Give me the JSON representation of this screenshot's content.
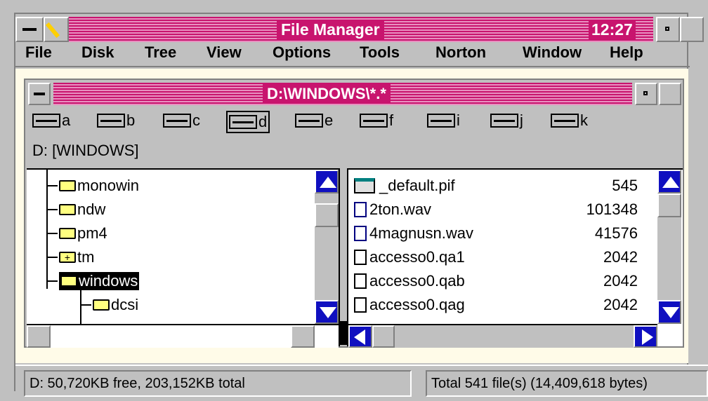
{
  "window": {
    "title": "File Manager",
    "clock": "12:27"
  },
  "menu": [
    {
      "label": "File"
    },
    {
      "label": "Disk"
    },
    {
      "label": "Tree"
    },
    {
      "label": "View"
    },
    {
      "label": "Options"
    },
    {
      "label": "Tools"
    },
    {
      "label": "Norton"
    },
    {
      "label": "Window"
    },
    {
      "label": "Help"
    }
  ],
  "child": {
    "title": "D:\\WINDOWS\\*.*",
    "path_label": "D: [WINDOWS]"
  },
  "drives": [
    {
      "letter": "a",
      "icon": "floppy-drive-icon"
    },
    {
      "letter": "b",
      "icon": "floppy-drive-icon"
    },
    {
      "letter": "c",
      "icon": "hard-drive-icon"
    },
    {
      "letter": "d",
      "icon": "hard-drive-icon",
      "selected": true
    },
    {
      "letter": "e",
      "icon": "hard-drive-icon"
    },
    {
      "letter": "f",
      "icon": "cdrom-drive-icon"
    },
    {
      "letter": "i",
      "icon": "network-drive-icon"
    },
    {
      "letter": "j",
      "icon": "network-drive-icon"
    },
    {
      "letter": "k",
      "icon": "network-drive-icon"
    }
  ],
  "tree": [
    {
      "name": "monowin",
      "icon": "folder-icon"
    },
    {
      "name": "ndw",
      "icon": "folder-icon"
    },
    {
      "name": "pm4",
      "icon": "folder-icon"
    },
    {
      "name": "tm",
      "icon": "folder-plus-icon"
    },
    {
      "name": "windows",
      "icon": "folder-open-icon",
      "selected": true
    },
    {
      "name": "dcsi",
      "icon": "folder-icon"
    }
  ],
  "files": [
    {
      "name": "_default.pif",
      "size": "545",
      "icon": "program-file-icon"
    },
    {
      "name": "2ton.wav",
      "size": "101348",
      "icon": "document-icon"
    },
    {
      "name": "4magnusn.wav",
      "size": "41576",
      "icon": "document-icon"
    },
    {
      "name": "accesso0.qa1",
      "size": "2042",
      "icon": "file-icon"
    },
    {
      "name": "accesso0.qab",
      "size": "2042",
      "icon": "file-icon"
    },
    {
      "name": "accesso0.qag",
      "size": "2042",
      "icon": "file-icon"
    }
  ],
  "status": {
    "left": "D: 50,720KB free,  203,152KB total",
    "right": "Total 541 file(s) (14,409,618 bytes)"
  },
  "colors": {
    "title": "#c8146e",
    "scroll_arrow": "#1010c0",
    "face": "#c0c0c0"
  }
}
